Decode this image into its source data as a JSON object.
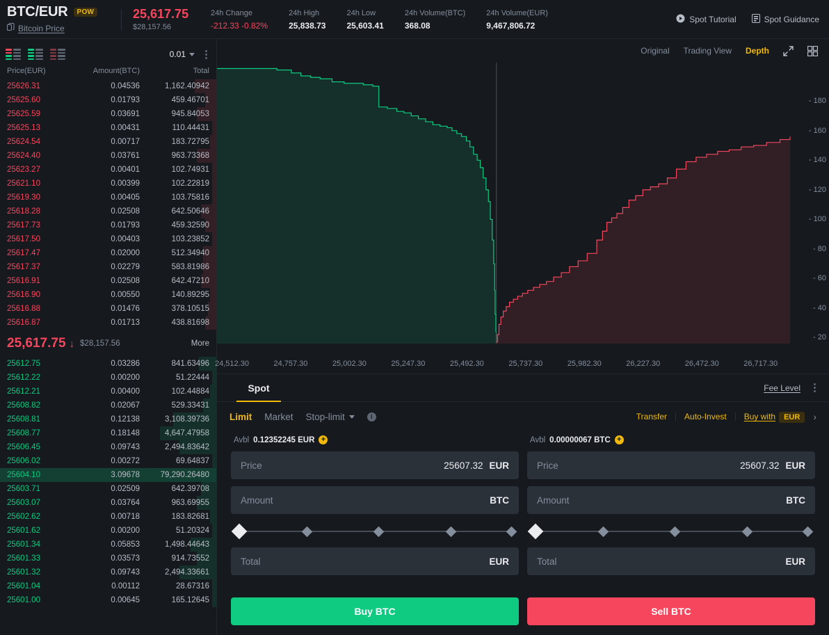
{
  "header": {
    "pair": "BTC/EUR",
    "badge": "POW",
    "sub_link": "Bitcoin Price",
    "copy_icon": "copy-icon",
    "price": "25,617.75",
    "price_usd": "$28,157.56",
    "stats": [
      {
        "label": "24h Change",
        "value": "-212.33 -0.82%",
        "down": true
      },
      {
        "label": "24h High",
        "value": "25,838.73",
        "down": false
      },
      {
        "label": "24h Low",
        "value": "25,603.41",
        "down": false
      },
      {
        "label": "24h Volume(BTC)",
        "value": "368.08",
        "down": false
      },
      {
        "label": "24h Volume(EUR)",
        "value": "9,467,806.72",
        "down": false
      }
    ],
    "links": [
      {
        "label": "Spot Tutorial",
        "icon": "play-circle-icon"
      },
      {
        "label": "Spot Guidance",
        "icon": "document-icon"
      }
    ]
  },
  "orderbook": {
    "view_modes": [
      "both-view-icon",
      "bids-view-icon",
      "asks-view-icon"
    ],
    "tick_size": "0.01",
    "columns": {
      "price": "Price(EUR)",
      "amount": "Amount(BTC)",
      "total": "Total"
    },
    "asks": [
      {
        "price": "25626.31",
        "amount": "0.04536",
        "total": "1,162.40942",
        "depth": 10
      },
      {
        "price": "25625.60",
        "amount": "0.01793",
        "total": "459.46701",
        "depth": 5
      },
      {
        "price": "25625.59",
        "amount": "0.03691",
        "total": "945.84053",
        "depth": 9
      },
      {
        "price": "25625.13",
        "amount": "0.00431",
        "total": "110.44431",
        "depth": 2
      },
      {
        "price": "25624.54",
        "amount": "0.00717",
        "total": "183.72795",
        "depth": 3
      },
      {
        "price": "25624.40",
        "amount": "0.03761",
        "total": "963.73368",
        "depth": 9
      },
      {
        "price": "25623.27",
        "amount": "0.00401",
        "total": "102.74931",
        "depth": 2
      },
      {
        "price": "25621.10",
        "amount": "0.00399",
        "total": "102.22819",
        "depth": 2
      },
      {
        "price": "25619.30",
        "amount": "0.00405",
        "total": "103.75816",
        "depth": 2
      },
      {
        "price": "25618.28",
        "amount": "0.02508",
        "total": "642.50646",
        "depth": 7
      },
      {
        "price": "25617.73",
        "amount": "0.01793",
        "total": "459.32590",
        "depth": 5
      },
      {
        "price": "25617.50",
        "amount": "0.00403",
        "total": "103.23852",
        "depth": 2
      },
      {
        "price": "25617.47",
        "amount": "0.02000",
        "total": "512.34940",
        "depth": 6
      },
      {
        "price": "25617.37",
        "amount": "0.02279",
        "total": "583.81986",
        "depth": 6
      },
      {
        "price": "25616.91",
        "amount": "0.02508",
        "total": "642.47210",
        "depth": 7
      },
      {
        "price": "25616.90",
        "amount": "0.00550",
        "total": "140.89295",
        "depth": 3
      },
      {
        "price": "25616.88",
        "amount": "0.01476",
        "total": "378.10515",
        "depth": 4
      },
      {
        "price": "25616.87",
        "amount": "0.01713",
        "total": "438.81698",
        "depth": 5
      }
    ],
    "mid": {
      "price": "25,617.75",
      "arrow": "↓",
      "usd": "$28,157.56",
      "more": "More"
    },
    "bids": [
      {
        "price": "25612.75",
        "amount": "0.03286",
        "total": "841.63496",
        "depth": 8,
        "hl": false
      },
      {
        "price": "25612.22",
        "amount": "0.00200",
        "total": "51.22444",
        "depth": 2,
        "hl": false
      },
      {
        "price": "25612.21",
        "amount": "0.00400",
        "total": "102.44884",
        "depth": 3,
        "hl": false
      },
      {
        "price": "25608.82",
        "amount": "0.02067",
        "total": "529.33431",
        "depth": 6,
        "hl": false
      },
      {
        "price": "25608.81",
        "amount": "0.12138",
        "total": "3,108.39736",
        "depth": 20,
        "hl": false
      },
      {
        "price": "25608.77",
        "amount": "0.18148",
        "total": "4,647.47958",
        "depth": 26,
        "hl": false
      },
      {
        "price": "25606.45",
        "amount": "0.09743",
        "total": "2,494.83642",
        "depth": 17,
        "hl": false
      },
      {
        "price": "25606.02",
        "amount": "0.00272",
        "total": "69.64837",
        "depth": 2,
        "hl": false
      },
      {
        "price": "25604.10",
        "amount": "3.09678",
        "total": "79,290.26480",
        "depth": 100,
        "hl": true
      },
      {
        "price": "25603.71",
        "amount": "0.02509",
        "total": "642.39708",
        "depth": 7,
        "hl": false
      },
      {
        "price": "25603.07",
        "amount": "0.03764",
        "total": "963.69955",
        "depth": 9,
        "hl": false
      },
      {
        "price": "25602.62",
        "amount": "0.00718",
        "total": "183.82681",
        "depth": 3,
        "hl": false
      },
      {
        "price": "25601.62",
        "amount": "0.00200",
        "total": "51.20324",
        "depth": 2,
        "hl": false
      },
      {
        "price": "25601.34",
        "amount": "0.05853",
        "total": "1,498.44643",
        "depth": 12,
        "hl": false
      },
      {
        "price": "25601.33",
        "amount": "0.03573",
        "total": "914.73552",
        "depth": 9,
        "hl": false
      },
      {
        "price": "25601.32",
        "amount": "0.09743",
        "total": "2,494.33661",
        "depth": 17,
        "hl": false
      },
      {
        "price": "25601.04",
        "amount": "0.00112",
        "total": "28.67316",
        "depth": 1,
        "hl": false
      },
      {
        "price": "25601.00",
        "amount": "0.00645",
        "total": "165.12645",
        "depth": 2,
        "hl": false
      }
    ]
  },
  "chart": {
    "tabs": [
      {
        "label": "Original",
        "active": false
      },
      {
        "label": "Trading View",
        "active": false
      },
      {
        "label": "Depth",
        "active": true
      }
    ],
    "icons": [
      "expand-icon",
      "grid-icon"
    ]
  },
  "chart_data": {
    "type": "area",
    "title": "",
    "xlabel": "",
    "ylabel": "",
    "grid": false,
    "legend": "none",
    "xlim": [
      24450,
      26840
    ],
    "ylim": [
      0,
      190
    ],
    "yticks": [
      20,
      40,
      60,
      80,
      100,
      120,
      140,
      160,
      180
    ],
    "xticks": [
      "24,512.30",
      "24,757.30",
      "25,002.30",
      "25,247.30",
      "25,492.30",
      "25,737.30",
      "25,982.30",
      "26,227.30",
      "26,472.30",
      "26,717.30"
    ],
    "xtick_values": [
      24512.3,
      24757.3,
      25002.3,
      25247.3,
      25492.3,
      25737.3,
      25982.3,
      26227.3,
      26472.3,
      26717.3
    ],
    "mid_price": 25615.25,
    "series": [
      {
        "name": "Bids",
        "color": "#0ecb81",
        "fill": "rgba(14,203,129,0.12)",
        "x": [
          24450,
          24560,
          24640,
          24700,
          24760,
          24800,
          24840,
          24880,
          24930,
          24980,
          25020,
          25060,
          25100,
          25120,
          25125,
          25160,
          25200,
          25230,
          25260,
          25290,
          25320,
          25350,
          25380,
          25410,
          25430,
          25450,
          25470,
          25490,
          25505,
          25520,
          25535,
          25548,
          25560,
          25572,
          25582,
          25590,
          25598,
          25604,
          25608,
          25610,
          25613,
          25615
        ],
        "y": [
          186,
          186,
          186,
          185,
          183,
          181,
          180,
          179,
          177,
          176,
          176,
          175,
          174,
          174,
          160,
          159,
          157,
          156,
          154,
          152,
          150,
          148,
          147,
          146,
          144,
          142,
          140,
          137,
          133,
          128,
          124,
          119,
          112,
          104,
          96,
          84,
          70,
          54,
          36,
          20,
          8,
          1
        ]
      },
      {
        "name": "Asks",
        "color": "#f6465d",
        "fill": "rgba(246,70,93,0.12)",
        "x": [
          25616,
          25620,
          25626,
          25634,
          25644,
          25656,
          25670,
          25686,
          25704,
          25724,
          25746,
          25770,
          25796,
          25824,
          25854,
          25886,
          25920,
          25956,
          25994,
          26034,
          26058,
          26076,
          26096,
          26118,
          26142,
          26168,
          26196,
          26226,
          26258,
          26292,
          26328,
          26366,
          26406,
          26448,
          26492,
          26538,
          26586,
          26636,
          26688,
          26742,
          26798,
          26840
        ],
        "y": [
          1,
          6,
          13,
          18,
          22,
          25,
          28,
          30,
          32,
          34,
          36,
          38,
          40,
          42,
          45,
          48,
          52,
          56,
          61,
          70,
          76,
          82,
          85,
          88,
          92,
          97,
          100,
          104,
          106,
          108,
          112,
          118,
          123,
          126,
          128,
          130,
          131,
          133,
          134,
          136,
          138,
          140
        ]
      }
    ]
  },
  "trade": {
    "tab": "Spot",
    "fee_level": "Fee Level",
    "kebab": "more-options-icon",
    "order_types": [
      {
        "label": "Limit",
        "active": true
      },
      {
        "label": "Market",
        "active": false
      }
    ],
    "stop_limit": "Stop-limit",
    "info_icon": "info-icon",
    "transfer": "Transfer",
    "auto_invest": "Auto-Invest",
    "buy_with": "Buy with",
    "buy_with_currency": "EUR",
    "buy": {
      "avbl_label": "Avbl",
      "avbl_value": "0.12352245 EUR",
      "price_placeholder": "Price",
      "price_value": "25607.32",
      "price_unit": "EUR",
      "amount_placeholder": "Amount",
      "amount_value": "",
      "amount_unit": "BTC",
      "total_placeholder": "Total",
      "total_value": "",
      "total_unit": "EUR",
      "action": "Buy BTC"
    },
    "sell": {
      "avbl_label": "Avbl",
      "avbl_value": "0.00000067 BTC",
      "price_placeholder": "Price",
      "price_value": "25607.32",
      "price_unit": "EUR",
      "amount_placeholder": "Amount",
      "amount_value": "",
      "amount_unit": "BTC",
      "total_placeholder": "Total",
      "total_value": "",
      "total_unit": "EUR",
      "action": "Sell BTC"
    }
  },
  "colors": {
    "bg": "#161a1e",
    "up": "#0ecb81",
    "down": "#f6465d",
    "accent": "#f0b90b",
    "text": "#eaecef",
    "muted": "#848e9c"
  }
}
